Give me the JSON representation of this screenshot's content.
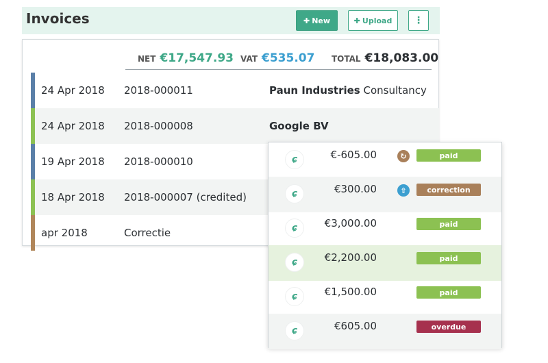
{
  "header": {
    "title": "Invoices",
    "new_label": "New",
    "upload_label": "Upload",
    "more_label": "⋮"
  },
  "totals": {
    "net_label": "NET",
    "net_value": "€17,547.93",
    "vat_label": "VAT",
    "vat_value": "€535.07",
    "total_label": "TOTAL",
    "total_value": "€18,083.00"
  },
  "invoices": [
    {
      "date": "24 Apr 2018",
      "number": "2018-000011",
      "client_bold": "Paun Industries",
      "client_rest": " Consultancy",
      "stripe": "#5a7fa8"
    },
    {
      "date": "24 Apr 2018",
      "number": "2018-000008",
      "client_bold": "Google BV",
      "client_rest": "",
      "stripe": "#8cc152"
    },
    {
      "date": "19 Apr 2018",
      "number": "2018-000010",
      "client_bold": "",
      "client_rest": "",
      "stripe": "#5a7fa8"
    },
    {
      "date": "18 Apr 2018",
      "number": "2018-000007 (credited)",
      "client_bold": "",
      "client_rest": "",
      "stripe": "#8cc152"
    },
    {
      "date": "apr 2018",
      "number": "Correctie",
      "client_bold": "",
      "client_rest": "",
      "stripe": "#b0865a"
    }
  ],
  "payments": [
    {
      "amount": "€-605.00",
      "status_icon": "refresh-icon",
      "status_icon_color": "#a9805a",
      "badge": "paid",
      "badge_color": "#8cc152"
    },
    {
      "amount": "€300.00",
      "status_icon": "cloud-upload-icon",
      "status_icon_color": "#3c9fd0",
      "badge": "correction",
      "badge_color": "#a9805a"
    },
    {
      "amount": "€3,000.00",
      "status_icon": "",
      "status_icon_color": "",
      "badge": "paid",
      "badge_color": "#8cc152"
    },
    {
      "amount": "€2,200.00",
      "status_icon": "",
      "status_icon_color": "",
      "badge": "paid",
      "badge_color": "#8cc152"
    },
    {
      "amount": "€1,500.00",
      "status_icon": "",
      "status_icon_color": "",
      "badge": "paid",
      "badge_color": "#8cc152"
    },
    {
      "amount": "€605.00",
      "status_icon": "",
      "status_icon_color": "",
      "badge": "overdue",
      "badge_color": "#a6314e"
    }
  ]
}
